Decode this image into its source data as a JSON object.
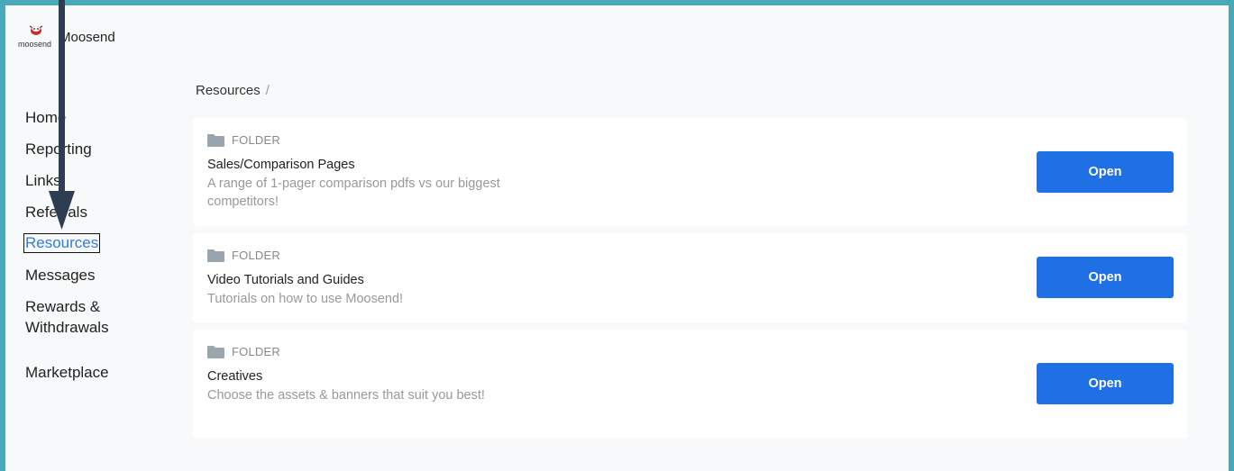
{
  "logo": {
    "mark_text": "moosend",
    "name": "Moosend"
  },
  "sidebar": {
    "items": [
      {
        "label": "Home"
      },
      {
        "label": "Reporting"
      },
      {
        "label": "Links"
      },
      {
        "label": "Referrals"
      },
      {
        "label": "Resources"
      },
      {
        "label": "Messages"
      },
      {
        "label": "Rewards &"
      },
      {
        "label": "Withdrawals"
      },
      {
        "label": "Marketplace"
      }
    ],
    "active": "Resources"
  },
  "breadcrumb": {
    "current": "Resources",
    "separator": "/"
  },
  "cards": [
    {
      "type_label": "FOLDER",
      "title": "Sales/Comparison Pages",
      "description": "A range of 1-pager comparison pdfs vs our biggest competitors!",
      "button": "Open"
    },
    {
      "type_label": "FOLDER",
      "title": "Video Tutorials and Guides",
      "description": "Tutorials on how to use Moosend!",
      "button": "Open"
    },
    {
      "type_label": "FOLDER",
      "title": "Creatives",
      "description": "Choose the assets & banners that suit you best!",
      "button": "Open"
    }
  ],
  "colors": {
    "frame_border": "#4aa9b6",
    "accent": "#2f7be6",
    "button": "#1f6fe5",
    "annotation_arrow": "#2f3d52"
  },
  "icons": {
    "folder": "folder-icon",
    "arrow": "annotation-arrow"
  }
}
